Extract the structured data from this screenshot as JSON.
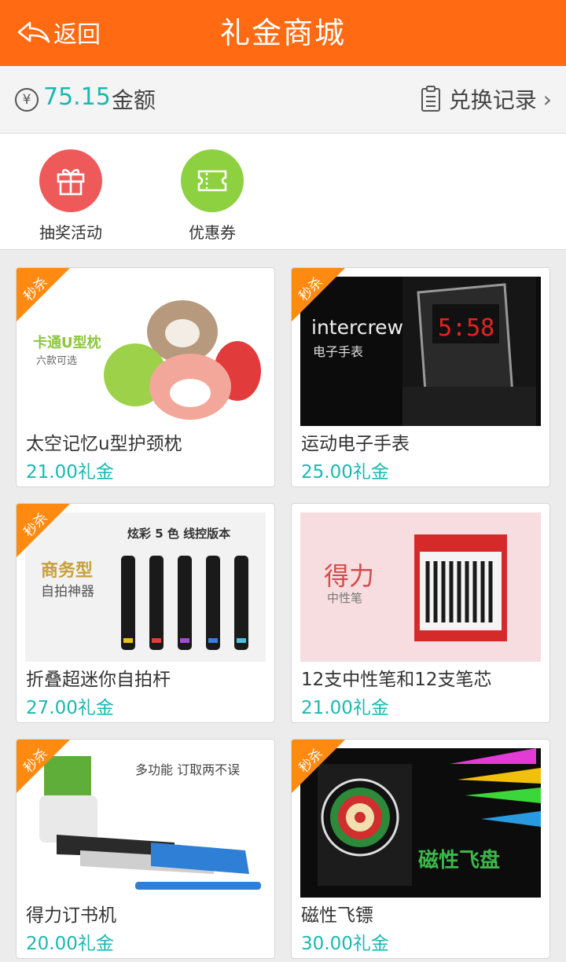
{
  "header": {
    "back_label": "返回",
    "title": "礼金商城"
  },
  "balance": {
    "amount": "75.15",
    "label": "金额",
    "records_label": "兑换记录"
  },
  "actions": [
    {
      "label": "抽奖活动",
      "color": "#ee5a5a",
      "icon": "gift-icon"
    },
    {
      "label": "优惠券",
      "color": "#8dd141",
      "icon": "ticket-icon"
    }
  ],
  "ribbon_text": "秒杀",
  "products": [
    {
      "name": "太空记忆u型护颈枕",
      "price": "21.00礼金",
      "img_text": [
        "卡通U型枕",
        "六款可选"
      ]
    },
    {
      "name": "运动电子手表",
      "price": "25.00礼金",
      "img_text": [
        "intercrew",
        "电子手表"
      ]
    },
    {
      "name": "折叠超迷你自拍杆",
      "price": "27.00礼金",
      "img_text": [
        "商务型",
        "自拍神器",
        "炫彩 5 色  线控版本"
      ]
    },
    {
      "name": "12支中性笔和12支笔芯",
      "price": "21.00礼金",
      "img_text": [
        "得力",
        "中性笔"
      ]
    },
    {
      "name": "得力订书机",
      "price": "20.00礼金",
      "img_text": [
        "多功能 订取两不误"
      ]
    },
    {
      "name": "磁性飞镖",
      "price": "30.00礼金",
      "img_text": [
        "磁性飞盘"
      ]
    }
  ]
}
